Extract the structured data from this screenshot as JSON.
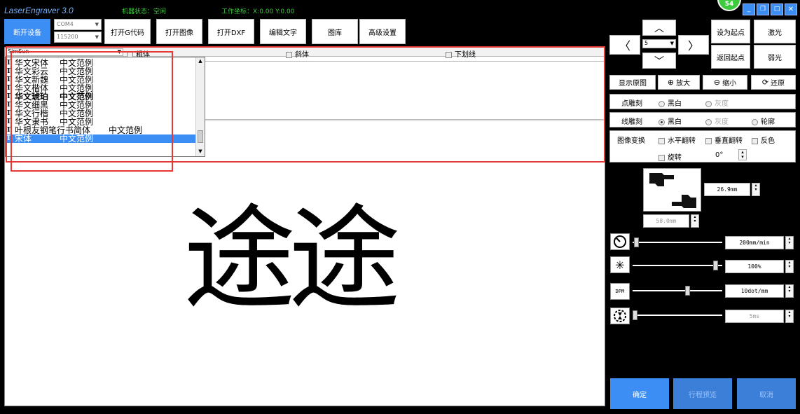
{
  "titlebar": {
    "app_title": "LaserEngraver 3.0",
    "machine_status": "机器状态：空闲",
    "work_coords": "工作坐标：X:0.00 Y:0.00",
    "badge": "54"
  },
  "toolbar": {
    "disconnect": "断开设备",
    "port": "COM4",
    "baud": "115200",
    "open_gcode": "打开G代码",
    "open_image": "打开图像",
    "open_dxf": "打开DXF",
    "edit_text": "编辑文字",
    "gallery": "图库",
    "advanced": "高级设置"
  },
  "text_options": {
    "font_selected": "SimSun",
    "bold": "粗体",
    "italic": "斜体",
    "underline": "下划线"
  },
  "font_list": [
    {
      "name": "华文宋体",
      "sample": "中文范例"
    },
    {
      "name": "华文彩云",
      "sample": "中文范例"
    },
    {
      "name": "华文新魏",
      "sample": "中文范例"
    },
    {
      "name": "华文楷体",
      "sample": "中文范例"
    },
    {
      "name": "华文琥珀",
      "sample": "中文范例"
    },
    {
      "name": "华文细黑",
      "sample": "中文范例"
    },
    {
      "name": "华文行楷",
      "sample": "中文范例"
    },
    {
      "name": "华文隶书",
      "sample": "中文范例"
    },
    {
      "name": "叶根友钢笔行书简体",
      "sample": "中文范例"
    },
    {
      "name": "宋体",
      "sample": "中文范例"
    }
  ],
  "canvas": {
    "text": "途途"
  },
  "jog": {
    "step": "5",
    "set_origin": "设为起点",
    "laser": "激光",
    "return_origin": "返回起点",
    "weak_light": "弱光"
  },
  "view": {
    "show_original": "显示原图",
    "zoom_in": "放大",
    "zoom_out": "缩小",
    "restore": "还原"
  },
  "dot_engrave": {
    "label": "点雕刻",
    "bw": "黑白",
    "gray": "灰度"
  },
  "line_engrave": {
    "label": "线雕刻",
    "bw": "黑白",
    "gray": "灰度",
    "outline": "轮廓"
  },
  "transform": {
    "label": "图像变换",
    "hflip": "水平翻转",
    "vflip": "垂直翻转",
    "invert": "反色",
    "rotate": "旋转",
    "angle": "0°"
  },
  "dimensions": {
    "width": "26.9mm",
    "height": "58.0mm"
  },
  "params": {
    "speed": "200mm/min",
    "power": "100%",
    "dpm_label": "DPM",
    "dpm": "10dot/mm",
    "delay": "5ms"
  },
  "params_levels": {
    "speed": 0.02,
    "power": 0.95,
    "dpm": 0.62,
    "delay": 0.0
  },
  "bottom": {
    "confirm": "确定",
    "preview": "行程预览",
    "cancel": "取消"
  },
  "colors": {
    "accent": "#3d8ef4",
    "highlight": "#e53935",
    "status_green": "#3ec93e"
  }
}
